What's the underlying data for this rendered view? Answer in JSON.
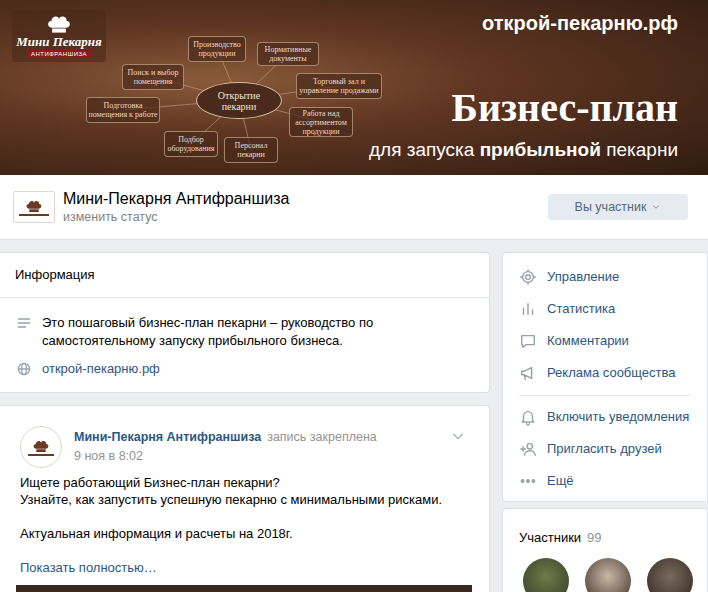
{
  "banner": {
    "logo": {
      "title": "Мини Пекарня",
      "subtitle": "АНТИФРАНШИЗА"
    },
    "site": "открой-пекарню.рф",
    "headline": "Бизнес-план",
    "tagline": [
      {
        "text": "для запуска ",
        "bold": false
      },
      {
        "text": "прибыльной",
        "bold": true
      },
      {
        "text": " пекарни",
        "bold": false
      }
    ],
    "mindmap": {
      "center": [
        "Открытие",
        "пекарни"
      ],
      "nodes": [
        {
          "lines": [
            "Производство",
            "продукции"
          ]
        },
        {
          "lines": [
            "Нормативные",
            "документы"
          ]
        },
        {
          "lines": [
            "Поиск и выбор",
            "помещения"
          ]
        },
        {
          "lines": [
            "Торговый зал и",
            "управление продажами"
          ]
        },
        {
          "lines": [
            "Подготовка",
            "помещения к работе"
          ]
        },
        {
          "lines": [
            "Работа над",
            "ассортиментом",
            "продукции"
          ]
        },
        {
          "lines": [
            "Подбор",
            "оборудования"
          ]
        },
        {
          "lines": [
            "Персонал",
            "пекарни"
          ]
        }
      ]
    }
  },
  "header": {
    "name": "Мини-Пекарня Антифраншиза",
    "status": "изменить статус",
    "member_button": "Вы участник"
  },
  "info": {
    "title": "Информация",
    "description": "Это пошаговый бизнес-план пекарни – руководство по самостоятельному запуску прибыльного бизнеса.",
    "link": "открой-пекарню.рф"
  },
  "post": {
    "author": "Мини-Пекарня Антифраншиза",
    "pinned": "запись закреплена",
    "date": "9 ноя в 8:02",
    "paragraphs": [
      [
        "Ищете работающий Бизнес-план пекарни?",
        "Узнайте, как запустить успешную пекарню с минимальными рисками."
      ],
      [
        "Актуальная информация и расчеты на 2018г."
      ]
    ],
    "more": "Показать полностью…"
  },
  "menu": {
    "admin": [
      {
        "label": "Управление"
      },
      {
        "label": "Статистика"
      },
      {
        "label": "Комментарии"
      },
      {
        "label": "Реклама сообщества"
      }
    ],
    "actions": [
      {
        "label": "Включить уведомления"
      },
      {
        "label": "Пригласить друзей"
      },
      {
        "label": "Ещё"
      }
    ]
  },
  "members": {
    "title": "Участники",
    "count": "99"
  }
}
